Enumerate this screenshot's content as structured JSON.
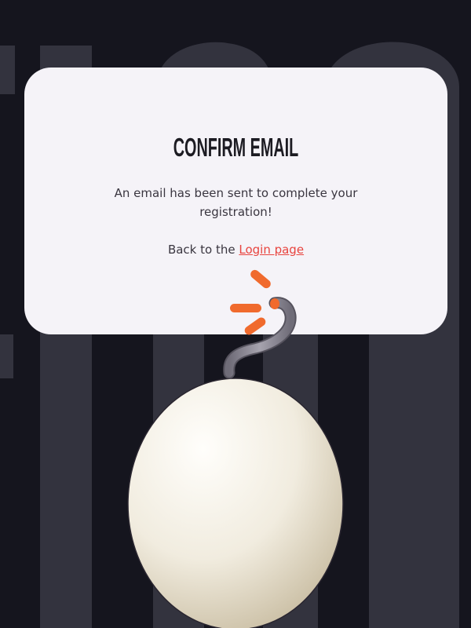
{
  "card": {
    "title": "CONFIRM EMAIL",
    "message": "An email has been sent to complete your registration!",
    "back_prefix": "Back to the",
    "login_link_label": "Login page"
  },
  "colors": {
    "background": "#15151e",
    "background_shapes": "#33333e",
    "card": "#f5f3f8",
    "title": "#1c1b22",
    "body_text": "#3a3640",
    "link": "#e8443f",
    "spark": "#f06a2d",
    "fuse": "#8e8b96",
    "egg": "#f3efe4"
  },
  "illustration": {
    "icon": "egg-bomb-icon",
    "fuse_icon": "fuse-icon",
    "spark_icon": "spark-icon"
  }
}
